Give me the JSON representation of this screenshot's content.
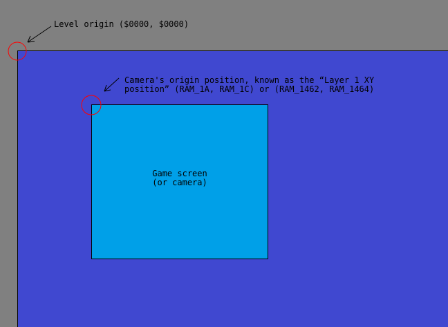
{
  "colors": {
    "background": "#808080",
    "level_fill": "#4048d0",
    "screen_fill": "#00a0e8",
    "marker": "#ff0000",
    "text": "#000000"
  },
  "level_origin": {
    "label": "Level origin ($0000, $0000)"
  },
  "camera_origin": {
    "label_line1": "Camera's origin position, known as the “Layer 1 XY",
    "label_line2": "position” (RAM_1A, RAM_1C) or (RAM_1462, RAM_1464)"
  },
  "game_screen": {
    "label_line1": "Game screen",
    "label_line2": "(or camera)"
  },
  "icons": {
    "level_origin_marker": "red-circle-icon",
    "camera_origin_marker": "red-circle-icon",
    "level_origin_pointer": "arrow-icon",
    "camera_origin_pointer": "arrow-icon"
  }
}
